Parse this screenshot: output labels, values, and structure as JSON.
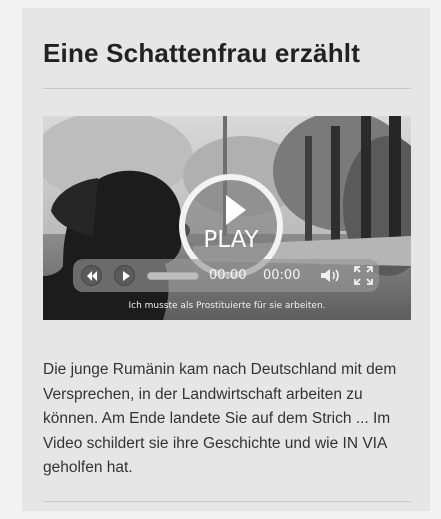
{
  "widget": {
    "title": "Eine Schattenfrau erzählt",
    "description": "Die junge Rumänin kam nach Deutschland mit dem Versprechen, in der Landwirtschaft arbeiten zu können. Am Ende landete Sie auf dem Strich ... Im Video schildert sie ihre Geschichte und wie IN VIA geholfen hat."
  },
  "video": {
    "play_label": "PLAY",
    "caption": "Ich musste als Prostituierte für sie arbeiten.",
    "current_time": "00:00",
    "duration": "00:00",
    "progress": 0,
    "icons": {
      "rewind": "rewind-icon",
      "play": "play-icon",
      "volume": "volume-icon",
      "fullscreen": "fullscreen-icon"
    }
  },
  "colors": {
    "card_background": "#e6e6e6",
    "title_text": "#222222",
    "body_text": "#333333"
  }
}
